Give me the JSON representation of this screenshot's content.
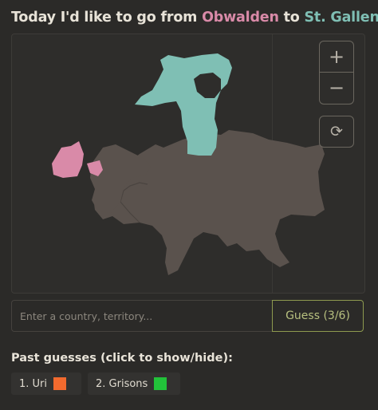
{
  "header": {
    "prefix": "Today I'd like to go from ",
    "from": "Obwalden",
    "middle": " to ",
    "to": "St. Gallen"
  },
  "colors": {
    "from": "#d98aa8",
    "to": "#7fbfb4",
    "territory": "#5a524d",
    "accent": "#8e9a4f"
  },
  "map_controls": {
    "zoom_in": "+",
    "zoom_out": "−",
    "reset": "⟳"
  },
  "guess_form": {
    "placeholder": "Enter a country, territory...",
    "button_label": "Guess (3/6)"
  },
  "past_guesses": {
    "title": "Past guesses (click to show/hide):",
    "items": [
      {
        "label": "1.  Uri",
        "color": "#f26a2e"
      },
      {
        "label": "2.  Grisons",
        "color": "#22c23a"
      }
    ]
  }
}
